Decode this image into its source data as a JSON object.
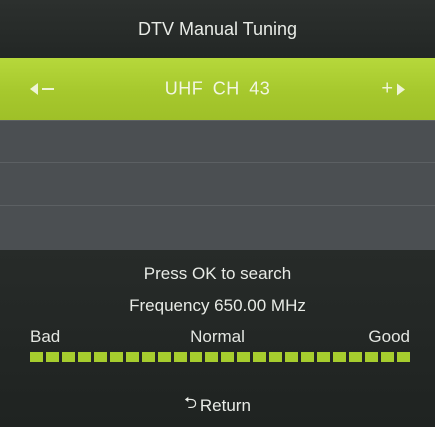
{
  "title": "DTV Manual Tuning",
  "channel": {
    "band": "UHF",
    "ch_label": "CH",
    "number": "43",
    "minus_glyph": "minus-icon",
    "plus_glyph": "+",
    "left_icon": "triangle-left-icon",
    "right_icon": "triangle-right-icon"
  },
  "status": {
    "prompt": "Press OK to search",
    "frequency": "Frequency 650.00 MHz"
  },
  "signal": {
    "bad_label": "Bad",
    "normal_label": "Normal",
    "good_label": "Good",
    "segments_total": 24,
    "segments_lit": 24,
    "quality_fraction": 1.0,
    "lit_color": "#a6cd2e"
  },
  "footer": {
    "return_icon": "return-icon",
    "return_label": "Return"
  },
  "colors": {
    "highlight": "#a6c82d",
    "background": "#262a28",
    "empty_row": "#4b4f52"
  }
}
